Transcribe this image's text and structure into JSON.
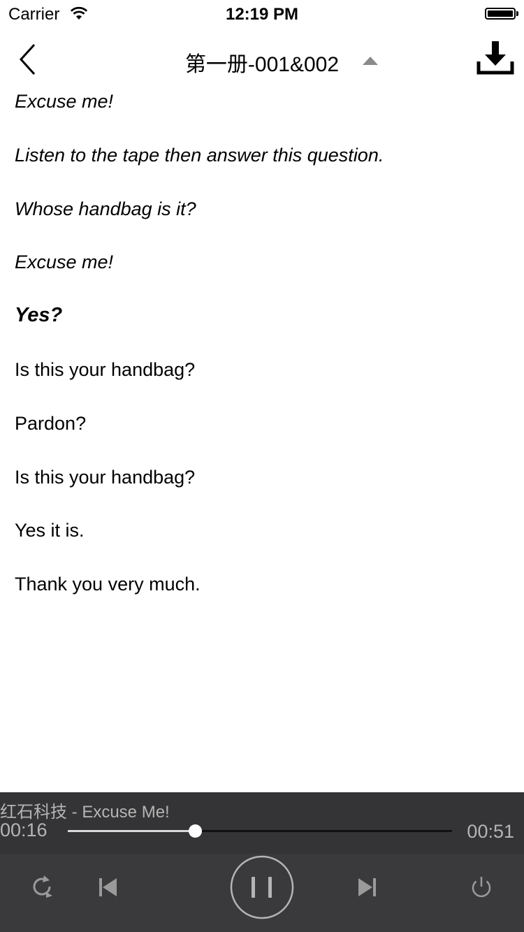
{
  "status_bar": {
    "carrier": "Carrier",
    "time": "12:19 PM"
  },
  "nav": {
    "title": "第一册-001&002",
    "back_icon": "chevron-left-icon",
    "caret_icon": "triangle-up-icon",
    "download_icon": "download-icon"
  },
  "lyrics": [
    {
      "text": "Excuse me!",
      "state": "past"
    },
    {
      "text": "Listen to the tape then answer this question.",
      "state": "past"
    },
    {
      "text": "Whose handbag is it?",
      "state": "past"
    },
    {
      "text": "Excuse me!",
      "state": "past"
    },
    {
      "text": "Yes?",
      "state": "current"
    },
    {
      "text": "Is this your handbag?",
      "state": "upcoming"
    },
    {
      "text": "Pardon?",
      "state": "upcoming"
    },
    {
      "text": "Is this your handbag?",
      "state": "upcoming"
    },
    {
      "text": "Yes it is.",
      "state": "upcoming"
    },
    {
      "text": "Thank you very much.",
      "state": "upcoming"
    }
  ],
  "player": {
    "track_title": "红石科技 - Excuse Me!",
    "elapsed": "00:16",
    "total": "00:51",
    "progress_fraction": 0.33,
    "controls": [
      "repeat-icon",
      "previous-track-icon",
      "pause-icon",
      "next-track-icon",
      "power-icon"
    ]
  },
  "colors": {
    "player_bg": "#3a3a3c",
    "player_text": "#b4b4b4",
    "caret": "#8a8a8a"
  }
}
